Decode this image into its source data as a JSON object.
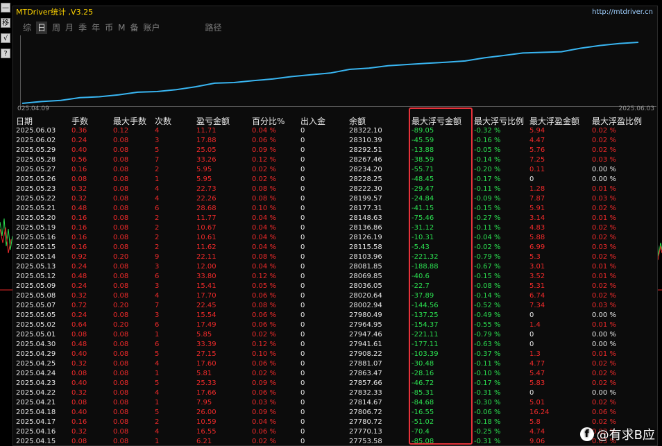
{
  "left_tools": [
    "—",
    "移",
    "√",
    "?"
  ],
  "window": {
    "title": "MTDriver统计 ,V3.25",
    "site": "http://mtdriver.cn"
  },
  "tabs": [
    "综",
    "日",
    "周",
    "月",
    "季",
    "年",
    "币",
    "M",
    "备",
    "账户",
    "路径"
  ],
  "active_tab": "日",
  "chart": {
    "start_label": "025.04.09",
    "end_label": "2025.06.03",
    "line_color": "#39b6f2"
  },
  "colors": {
    "highlight": "#e8323a",
    "loss": "#2bdf50",
    "gain": "#ee2a2a"
  },
  "table": {
    "headers": [
      "日期",
      "手数",
      "最大手数",
      "次数",
      "盈亏金额",
      "百分比%",
      "出入金",
      "余额",
      "最大浮亏金额",
      "最大浮亏比例",
      "最大浮盈金额",
      "最大浮盈比例"
    ],
    "rows": [
      [
        "2025.06.03",
        "0.36",
        "0.12",
        "4",
        "11.71",
        "0.04 %",
        "0",
        "28322.10",
        "-89.05",
        "-0.32 %",
        "5.94",
        "0.02 %"
      ],
      [
        "2025.06.02",
        "0.24",
        "0.08",
        "3",
        "17.88",
        "0.06 %",
        "0",
        "28310.39",
        "-45.59",
        "-0.16 %",
        "4.47",
        "0.02 %"
      ],
      [
        "2025.05.29",
        "0.40",
        "0.08",
        "5",
        "25.05",
        "0.09 %",
        "0",
        "28292.51",
        "-13.88",
        "-0.05 %",
        "5.76",
        "0.02 %"
      ],
      [
        "2025.05.28",
        "0.56",
        "0.08",
        "7",
        "33.26",
        "0.12 %",
        "0",
        "28267.46",
        "-38.59",
        "-0.14 %",
        "7.25",
        "0.03 %"
      ],
      [
        "2025.05.27",
        "0.16",
        "0.08",
        "2",
        "5.95",
        "0.02 %",
        "0",
        "28234.20",
        "-55.71",
        "-0.20 %",
        "0.11",
        "0.00 %"
      ],
      [
        "2025.05.26",
        "0.08",
        "0.08",
        "1",
        "5.95",
        "0.02 %",
        "0",
        "28228.25",
        "-48.45",
        "-0.17 %",
        "0",
        "0.00 %"
      ],
      [
        "2025.05.23",
        "0.32",
        "0.08",
        "4",
        "22.73",
        "0.08 %",
        "0",
        "28222.30",
        "-29.47",
        "-0.11 %",
        "1.28",
        "0.01 %"
      ],
      [
        "2025.05.22",
        "0.32",
        "0.08",
        "4",
        "22.26",
        "0.08 %",
        "0",
        "28199.57",
        "-24.84",
        "-0.09 %",
        "7.87",
        "0.03 %"
      ],
      [
        "2025.05.21",
        "0.48",
        "0.08",
        "6",
        "28.68",
        "0.10 %",
        "0",
        "28177.31",
        "-41.15",
        "-0.15 %",
        "5.91",
        "0.02 %"
      ],
      [
        "2025.05.20",
        "0.16",
        "0.08",
        "2",
        "11.77",
        "0.04 %",
        "0",
        "28148.63",
        "-75.46",
        "-0.27 %",
        "3.14",
        "0.01 %"
      ],
      [
        "2025.05.19",
        "0.16",
        "0.08",
        "2",
        "10.67",
        "0.04 %",
        "0",
        "28136.86",
        "-31.12",
        "-0.11 %",
        "4.83",
        "0.02 %"
      ],
      [
        "2025.05.16",
        "0.16",
        "0.08",
        "2",
        "10.61",
        "0.04 %",
        "0",
        "28126.19",
        "-10.31",
        "-0.04 %",
        "5.88",
        "0.02 %"
      ],
      [
        "2025.05.15",
        "0.16",
        "0.08",
        "2",
        "11.62",
        "0.04 %",
        "0",
        "28115.58",
        "-5.43",
        "-0.02 %",
        "6.99",
        "0.03 %"
      ],
      [
        "2025.05.14",
        "0.92",
        "0.20",
        "9",
        "22.11",
        "0.08 %",
        "0",
        "28103.96",
        "-221.32",
        "-0.79 %",
        "5.3",
        "0.02 %"
      ],
      [
        "2025.05.13",
        "0.24",
        "0.08",
        "3",
        "12.00",
        "0.04 %",
        "0",
        "28081.85",
        "-188.88",
        "-0.67 %",
        "3.01",
        "0.01 %"
      ],
      [
        "2025.05.12",
        "0.48",
        "0.08",
        "6",
        "33.80",
        "0.12 %",
        "0",
        "28069.85",
        "-40.6",
        "-0.15 %",
        "3.52",
        "0.01 %"
      ],
      [
        "2025.05.09",
        "0.24",
        "0.08",
        "3",
        "15.41",
        "0.05 %",
        "0",
        "28036.05",
        "-22.7",
        "-0.08 %",
        "5.31",
        "0.02 %"
      ],
      [
        "2025.05.08",
        "0.32",
        "0.08",
        "4",
        "17.70",
        "0.06 %",
        "0",
        "28020.64",
        "-37.89",
        "-0.14 %",
        "6.74",
        "0.02 %"
      ],
      [
        "2025.05.07",
        "0.72",
        "0.20",
        "7",
        "22.45",
        "0.08 %",
        "0",
        "28002.94",
        "-144.56",
        "-0.52 %",
        "7.34",
        "0.03 %"
      ],
      [
        "2025.05.05",
        "0.24",
        "0.08",
        "3",
        "15.54",
        "0.06 %",
        "0",
        "27980.49",
        "-137.25",
        "-0.49 %",
        "0",
        "0.00 %"
      ],
      [
        "2025.05.02",
        "0.64",
        "0.20",
        "6",
        "17.49",
        "0.06 %",
        "0",
        "27964.95",
        "-154.37",
        "-0.55 %",
        "1.4",
        "0.01 %"
      ],
      [
        "2025.05.01",
        "0.08",
        "0.08",
        "1",
        "5.85",
        "0.02 %",
        "0",
        "27947.46",
        "-221.11",
        "-0.79 %",
        "0",
        "0.00 %"
      ],
      [
        "2025.04.30",
        "0.48",
        "0.08",
        "6",
        "33.39",
        "0.12 %",
        "0",
        "27941.61",
        "-177.11",
        "-0.63 %",
        "0",
        "0.00 %"
      ],
      [
        "2025.04.29",
        "0.40",
        "0.08",
        "5",
        "27.15",
        "0.10 %",
        "0",
        "27908.22",
        "-103.39",
        "-0.37 %",
        "1.3",
        "0.01 %"
      ],
      [
        "2025.04.25",
        "0.32",
        "0.08",
        "4",
        "17.60",
        "0.06 %",
        "0",
        "27881.07",
        "-30.48",
        "-0.11 %",
        "4.77",
        "0.02 %"
      ],
      [
        "2025.04.24",
        "0.08",
        "0.08",
        "1",
        "5.81",
        "0.02 %",
        "0",
        "27863.47",
        "-28.16",
        "-0.10 %",
        "5.47",
        "0.02 %"
      ],
      [
        "2025.04.23",
        "0.40",
        "0.08",
        "5",
        "25.33",
        "0.09 %",
        "0",
        "27857.66",
        "-46.72",
        "-0.17 %",
        "5.83",
        "0.02 %"
      ],
      [
        "2025.04.22",
        "0.32",
        "0.08",
        "4",
        "17.66",
        "0.06 %",
        "0",
        "27832.33",
        "-85.31",
        "-0.31 %",
        "0",
        "0.00 %"
      ],
      [
        "2025.04.21",
        "0.08",
        "0.08",
        "1",
        "7.95",
        "0.03 %",
        "0",
        "27814.67",
        "-84.68",
        "-0.30 %",
        "5.01",
        "0.02 %"
      ],
      [
        "2025.04.18",
        "0.40",
        "0.08",
        "5",
        "26.00",
        "0.09 %",
        "0",
        "27806.72",
        "-16.55",
        "-0.06 %",
        "16.24",
        "0.06 %"
      ],
      [
        "2025.04.17",
        "0.16",
        "0.08",
        "2",
        "10.59",
        "0.04 %",
        "0",
        "27780.72",
        "-51.02",
        "-0.18 %",
        "5.8",
        "0.02 %"
      ],
      [
        "2025.04.16",
        "0.32",
        "0.08",
        "4",
        "16.55",
        "0.06 %",
        "0",
        "27770.13",
        "-70.4",
        "-0.25 %",
        "4.74",
        "0.02 %"
      ],
      [
        "2025.04.15",
        "0.08",
        "0.08",
        "1",
        "6.21",
        "0.02 %",
        "0",
        "27753.58",
        "-85.08",
        "-0.31 %",
        "9.06",
        "0.03 %"
      ]
    ]
  },
  "watermark": {
    "icon": "facebook-icon",
    "text": "@有求B应"
  }
}
